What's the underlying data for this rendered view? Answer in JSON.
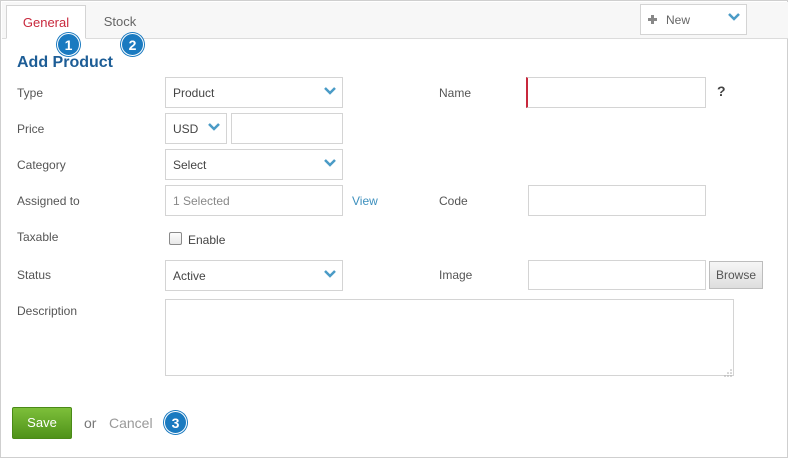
{
  "tabs": {
    "general": "General",
    "stock": "Stock"
  },
  "new_button": {
    "label": "New"
  },
  "badges": {
    "one": "1",
    "two": "2",
    "three": "3"
  },
  "form": {
    "title": "Add Product",
    "type": {
      "label": "Type",
      "value": "Product"
    },
    "price": {
      "label": "Price",
      "currency": "USD",
      "amount": ""
    },
    "category": {
      "label": "Category",
      "value": "Select"
    },
    "assigned": {
      "label": "Assigned to",
      "value": "1 Selected",
      "view_link": "View"
    },
    "taxable": {
      "label": "Taxable",
      "checkbox_label": "Enable",
      "checked": false
    },
    "status": {
      "label": "Status",
      "value": "Active"
    },
    "description": {
      "label": "Description",
      "value": ""
    },
    "name": {
      "label": "Name",
      "value": "",
      "help": "?"
    },
    "code": {
      "label": "Code",
      "value": ""
    },
    "image": {
      "label": "Image",
      "value": "",
      "browse": "Browse"
    }
  },
  "actions": {
    "save": "Save",
    "or": "or",
    "cancel": "Cancel"
  },
  "colors": {
    "active_tab": "#c8283c",
    "title": "#1d5d96",
    "badge": "#1a7ac0",
    "link": "#3c8fbd",
    "save": "#5ea524",
    "chevron": "#4a9bc6"
  },
  "icons": {
    "new": "plus-icon",
    "dropdown": "chevron-down-icon",
    "resize": "resize-grip-icon"
  }
}
